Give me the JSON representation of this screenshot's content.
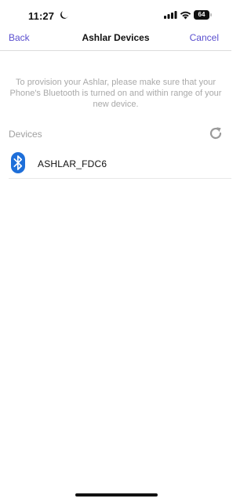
{
  "status_bar": {
    "time": "11:27",
    "battery": "64"
  },
  "nav": {
    "back_label": "Back",
    "title": "Ashlar Devices",
    "cancel_label": "Cancel"
  },
  "instructions": "To provision your Ashlar, please make sure that your Phone's Bluetooth is turned on and within range of your new device.",
  "devices": {
    "header": "Devices",
    "items": [
      {
        "name": "ASHLAR_FDC6",
        "icon": "bluetooth-icon"
      }
    ]
  },
  "colors": {
    "accent": "#5a4fcf",
    "bluetooth": "#1e6fd9",
    "muted_text": "#a9a9a9"
  }
}
